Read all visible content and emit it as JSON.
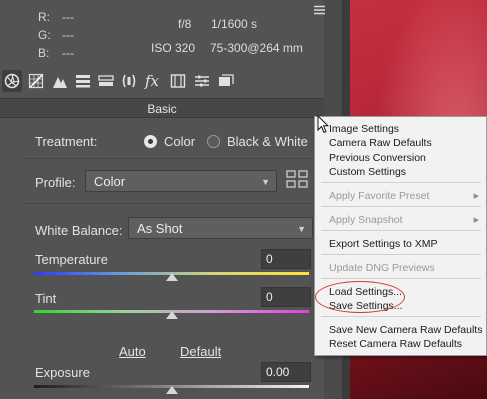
{
  "info": {
    "r_label": "R:",
    "r_value": "---",
    "g_label": "G:",
    "g_value": "---",
    "b_label": "B:",
    "b_value": "---",
    "aperture": "f/8",
    "shutter": "1/1600 s",
    "iso": "ISO 320",
    "lens": "75-300@264 mm"
  },
  "tab": {
    "title": "Basic"
  },
  "treatment": {
    "label": "Treatment:",
    "color_option": "Color",
    "bw_option": "Black & White",
    "selected": "Color"
  },
  "profile": {
    "label": "Profile:",
    "value": "Color"
  },
  "white_balance": {
    "label": "White Balance:",
    "value": "As Shot"
  },
  "temperature": {
    "label": "Temperature",
    "value": "0",
    "level": 0.5
  },
  "tint": {
    "label": "Tint",
    "value": "0",
    "level": 0.5
  },
  "tone_links": {
    "auto": "Auto",
    "default": "Default"
  },
  "exposure": {
    "label": "Exposure",
    "value": "0.00",
    "level": 0.5
  },
  "menu": {
    "image_settings": "Image Settings",
    "camera_raw_defaults": "Camera Raw Defaults",
    "previous_conversion": "Previous Conversion",
    "custom_settings": "Custom Settings",
    "apply_favorite_preset": "Apply Favorite Preset",
    "apply_snapshot": "Apply Snapshot",
    "export_settings": "Export Settings to XMP",
    "update_dng": "Update DNG Previews",
    "load_settings": "Load Settings...",
    "save_settings": "Save Settings...",
    "save_new_defaults": "Save New Camera Raw Defaults",
    "reset_defaults": "Reset Camera Raw Defaults"
  },
  "colors": {
    "panel_bg": "#535353",
    "highlight_ring": "#d43a3a",
    "preview_red": "#b9283a"
  },
  "icons": {
    "toolbar": [
      "basic-aperture-icon",
      "tone-curve-icon",
      "detail-icon",
      "hsl-icon",
      "split-toning-icon",
      "lens-corrections-icon",
      "effects-fx-icon",
      "camera-calibration-icon",
      "presets-icon",
      "snapshots-icon"
    ]
  }
}
